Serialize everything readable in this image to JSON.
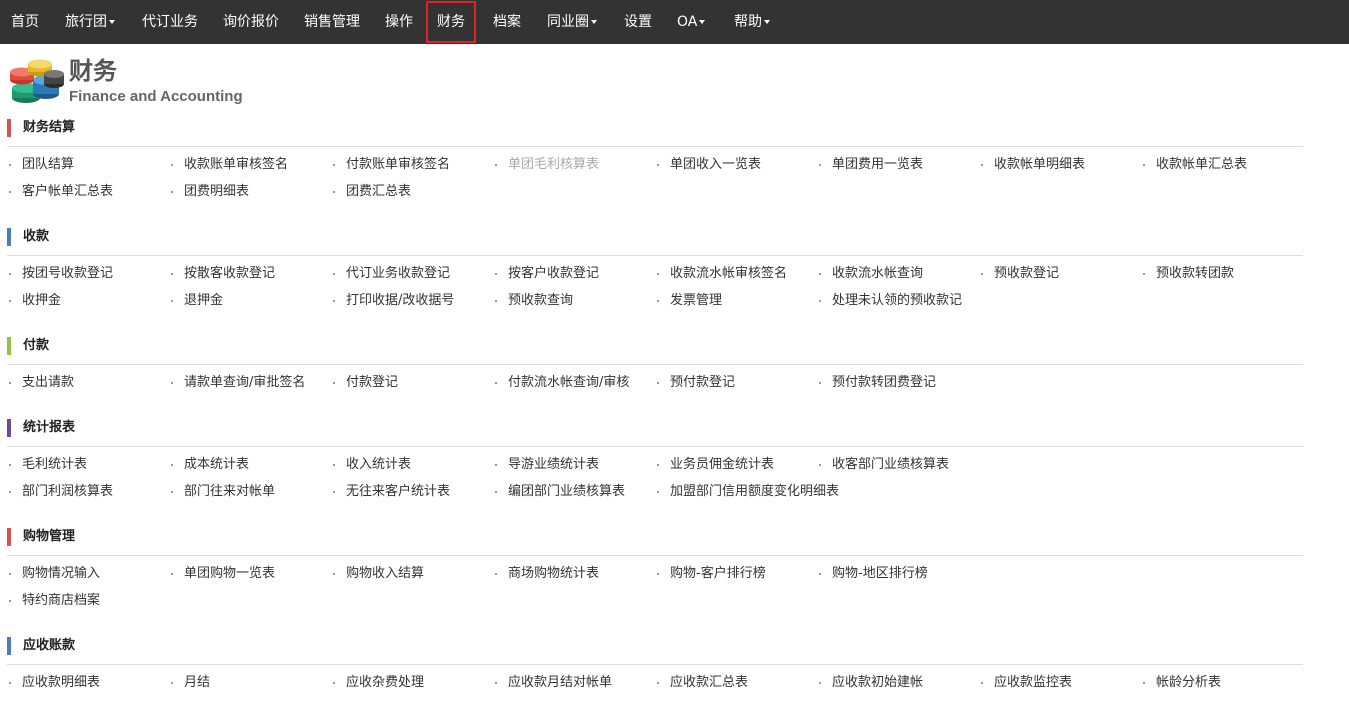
{
  "nav": {
    "items": [
      {
        "label": "首页",
        "caret": false
      },
      {
        "label": "旅行团",
        "caret": true
      },
      {
        "label": "代订业务",
        "caret": false
      },
      {
        "label": "询价报价",
        "caret": false
      },
      {
        "label": "销售管理",
        "caret": false
      },
      {
        "label": "操作",
        "caret": false
      },
      {
        "label": "财务",
        "caret": false,
        "active": true
      },
      {
        "label": "档案",
        "caret": false
      },
      {
        "label": "同业圈",
        "caret": true
      },
      {
        "label": "设置",
        "caret": false
      },
      {
        "label": "OA",
        "caret": true
      },
      {
        "label": "帮助",
        "caret": true
      }
    ]
  },
  "header": {
    "title_cn": "财务",
    "title_en": "Finance and Accounting",
    "icon": "coins-stack-icon"
  },
  "colors": {
    "navbar_bg": "#333333",
    "active_outline": "#e0202a",
    "section_red": "#d9534f",
    "section_blue": "#4a7cc0",
    "section_green": "#8cc63f",
    "section_purple": "#6f4a9a"
  },
  "sections": [
    {
      "title": "财务结算",
      "color": "#d9534f",
      "rows": [
        [
          "团队结算",
          "收款账单审核签名",
          "付款账单审核签名",
          "单团毛利核算表",
          "单团收入一览表",
          "单团费用一览表",
          "收款帐单明细表",
          "收款帐单汇总表"
        ],
        [
          "客户帐单汇总表",
          "团费明细表",
          "团费汇总表"
        ]
      ],
      "disabled": [
        "单团毛利核算表"
      ]
    },
    {
      "title": "收款",
      "color": "#4a7cc0",
      "rows": [
        [
          "按团号收款登记",
          "按散客收款登记",
          "代订业务收款登记",
          "按客户收款登记",
          "收款流水帐审核签名",
          "收款流水帐查询",
          "预收款登记",
          "预收款转团款"
        ],
        [
          "收押金",
          "退押金",
          "打印收据/改收据号",
          "预收款查询",
          "发票管理",
          "处理未认领的预收款记"
        ]
      ],
      "disabled": []
    },
    {
      "title": "付款",
      "color": "#8cc63f",
      "rows": [
        [
          "支出请款",
          "请款单查询/审批签名",
          "付款登记",
          "付款流水帐查询/审核",
          "预付款登记",
          "预付款转团费登记"
        ]
      ],
      "disabled": []
    },
    {
      "title": "统计报表",
      "color": "#6f4a9a",
      "rows": [
        [
          "毛利统计表",
          "成本统计表",
          "收入统计表",
          "导游业绩统计表",
          "业务员佣金统计表",
          "收客部门业绩核算表"
        ],
        [
          "部门利润核算表",
          "部门往来对帐单",
          "无往来客户统计表",
          "编团部门业绩核算表",
          "加盟部门信用额度变化明细表"
        ]
      ],
      "disabled": []
    },
    {
      "title": "购物管理",
      "color": "#d9534f",
      "rows": [
        [
          "购物情况输入",
          "单团购物一览表",
          "购物收入结算",
          "商场购物统计表",
          "购物-客户排行榜",
          "购物-地区排行榜"
        ],
        [
          "特约商店档案"
        ]
      ],
      "disabled": []
    },
    {
      "title": "应收账款",
      "color": "#4a7cc0",
      "rows": [
        [
          "应收款明细表",
          "月结",
          "应收杂费处理",
          "应收款月结对帐单",
          "应收款汇总表",
          "应收款初始建帐",
          "应收款监控表",
          "帐龄分析表"
        ]
      ],
      "disabled": []
    }
  ]
}
